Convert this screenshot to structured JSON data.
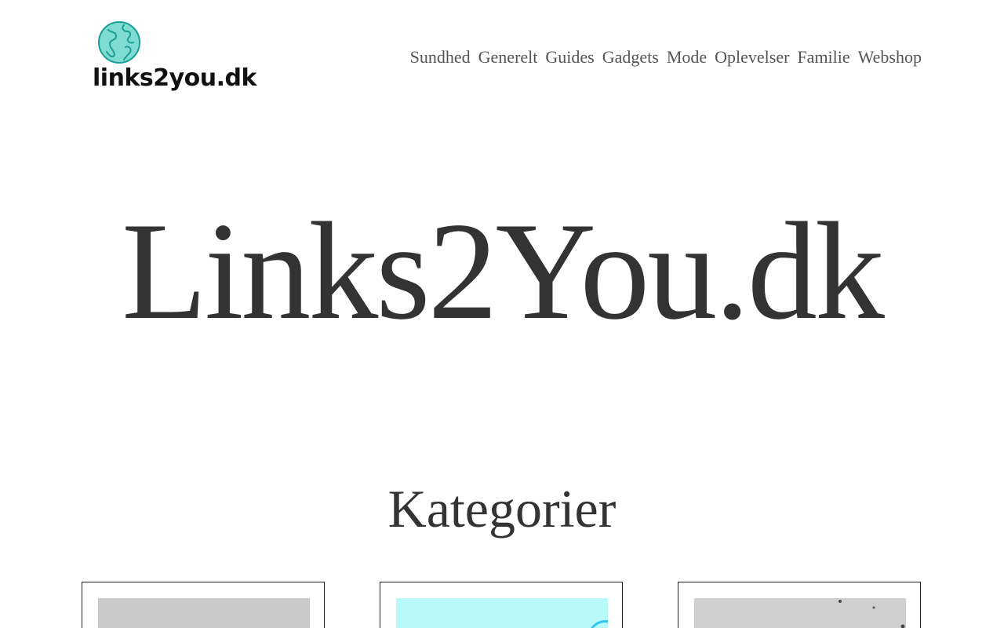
{
  "header": {
    "logo_text": "links2you.dk",
    "logo_icon": "globe-icon",
    "nav_items": [
      "Sundhed",
      "Generelt",
      "Guides",
      "Gadgets",
      "Mode",
      "Oplevelser",
      "Familie",
      "Webshop"
    ]
  },
  "hero": {
    "title": "Links2You.dk"
  },
  "categories": {
    "heading": "Kategorier",
    "cards": [
      {
        "image_color": "#c9c9c9"
      },
      {
        "image_color": "#b8fafa"
      },
      {
        "image_color": "#cfcfcf"
      }
    ]
  },
  "colors": {
    "text": "#333333",
    "nav": "#555555",
    "logo_globe": "#7fdcd2",
    "logo_outline": "#1a9e97"
  }
}
